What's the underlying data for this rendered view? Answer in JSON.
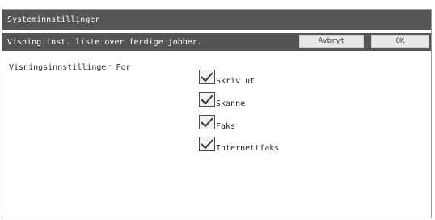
{
  "window": {
    "title": "Systeminnstillinger"
  },
  "header": {
    "title": "Visning.inst. liste over ferdige jobber.",
    "cancel_label": "Avbryt",
    "ok_label": "OK"
  },
  "settings": {
    "section_label": "Visningsinnstillinger For",
    "options": [
      {
        "label": "Skriv ut",
        "checked": true
      },
      {
        "label": "Skanne",
        "checked": true
      },
      {
        "label": "Faks",
        "checked": true
      },
      {
        "label": "Internettfaks",
        "checked": true
      }
    ]
  },
  "colors": {
    "bar": "#555555",
    "button": "#e8e8e8"
  }
}
